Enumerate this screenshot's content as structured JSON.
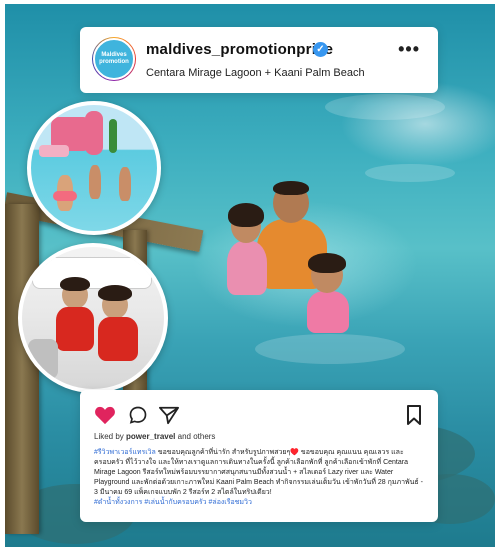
{
  "header": {
    "username": "maldives_promotionprice",
    "subtitle": "Centara Mirage Lagoon + Kaani Palm Beach",
    "avatar_text_line1": "Maldives",
    "avatar_text_line2": "promotion",
    "verified_icon": "verified-badge-icon",
    "more_icon": "more-options-icon"
  },
  "actions": {
    "like_icon": "heart-icon",
    "comment_icon": "comment-icon",
    "share_icon": "share-icon",
    "save_icon": "bookmark-icon",
    "like_color": "#e0245e"
  },
  "post": {
    "liked_prefix": "Liked by",
    "liked_user": "power_travel",
    "liked_suffix": "and others",
    "caption_tag": "#รีวิวพาเวอร์แทรเวิล",
    "caption_text": "ขอขอบคุณลูกค้าที่น่ารัก สำหรับรูปภาพสวยๆ♥️ ขอขอบคุณ คุณแนน คุณเลวร และครอบครัว ที่ไว้วางใจ และให้ทางเราดูแลการเดินทางในครั้งนี้ ลูกค้าเลือกพักที่ ลูกค้าเลือกเข้าพักที่ Centara Mirage Lagoon รีสอร์ทใหม่พร้อมบรรยากาศสนุกสนานมีทั้งสวนน้ำ + สไลเดอร์ Lazy river และ Water Playground และพักต่อด้วยเกาะภาพใหม่ Kaani Palm Beach ทำกิจกรรมเล่นเต็มวัน เข้าพักวันที่ 28 กุมภาพันธ์ - 3 มีนาคม 69 แพ็คเกจแบบพัก 2 รีสอร์ท 2 สไตล์ในทริปเดียว!",
    "tags": "#ดำน้ำทั้งวงการ #เล่นน้ำกับครอบครัว #ล่องเรือชมวิว"
  }
}
